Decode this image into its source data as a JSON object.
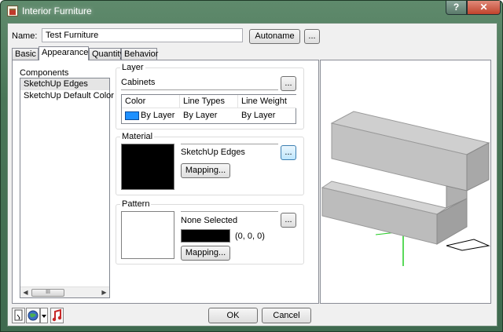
{
  "window": {
    "title": "Interior Furniture",
    "help_label": "?",
    "close_label": "✕"
  },
  "name_row": {
    "label": "Name:",
    "value": "Test Furniture",
    "autoname_label": "Autoname",
    "more_label": "..."
  },
  "tabs": [
    {
      "label": "Basic",
      "active": false
    },
    {
      "label": "Appearance",
      "active": true
    },
    {
      "label": "Quantity",
      "active": false
    },
    {
      "label": "Behavior",
      "active": false
    }
  ],
  "components": {
    "label": "Components",
    "items": [
      "SketchUp Edges",
      "SketchUp Default Color"
    ],
    "selected_index": 0,
    "scroll_thumb": "III"
  },
  "layer": {
    "title": "Layer",
    "value": "Cabinets",
    "browse_label": "...",
    "columns": [
      "Color",
      "Line Types",
      "Line Weight"
    ],
    "row": {
      "color": "By Layer",
      "line_type": "By Layer",
      "line_weight": "By Layer"
    },
    "swatch_color": "#1e90ff"
  },
  "material": {
    "title": "Material",
    "value": "SketchUp Edges",
    "browse_label": "...",
    "mapping_label": "Mapping...",
    "swatch_color": "#000000"
  },
  "pattern": {
    "title": "Pattern",
    "value": "None Selected",
    "browse_label": "...",
    "color_rgb": "(0, 0, 0)",
    "color_swatch": "#000000",
    "mapping_label": "Mapping..."
  },
  "footer": {
    "ok_label": "OK",
    "cancel_label": "Cancel",
    "icons": [
      "document-icon",
      "globe-icon",
      "dropdown-arrow-icon",
      "music-note-icon"
    ]
  },
  "colors": {
    "titlebar": "#4a7658",
    "dialog_bg": "#f0f0f0",
    "selection": "#e5e5e5",
    "accent_blue": "#3c7fb1"
  }
}
